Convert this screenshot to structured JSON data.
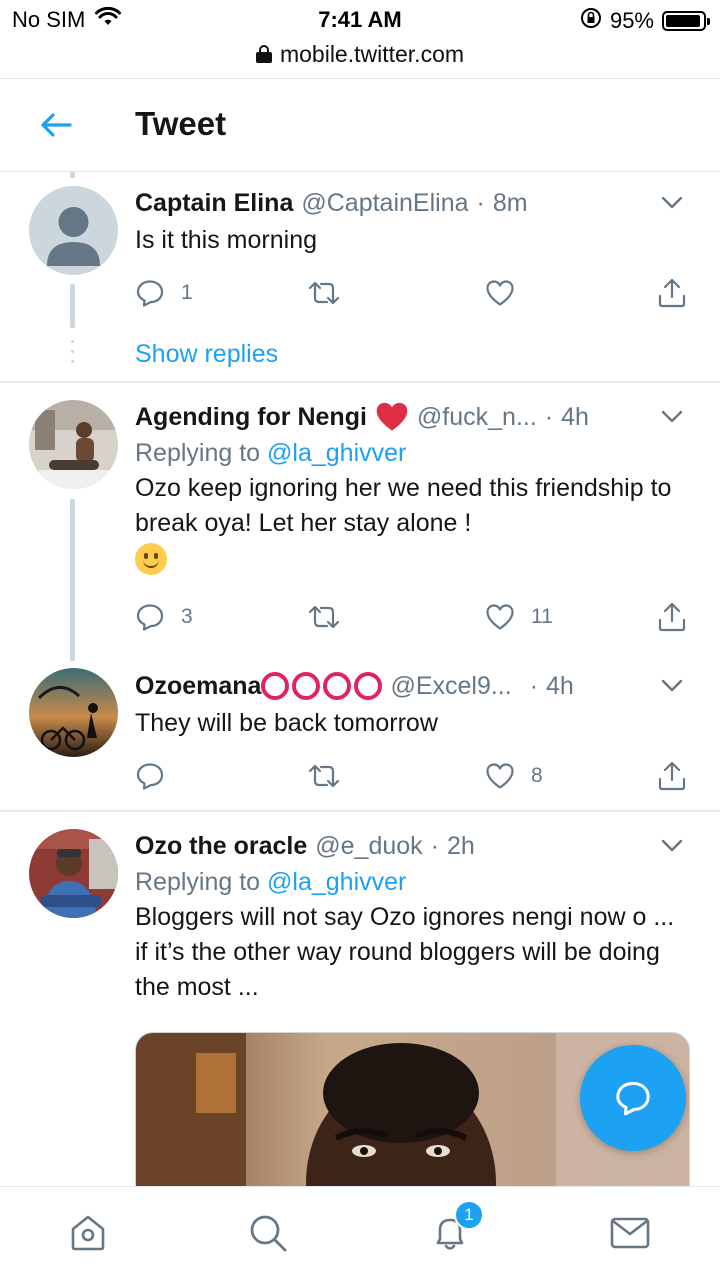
{
  "status_bar": {
    "carrier": "No SIM",
    "time": "7:41 AM",
    "battery_percent": "95%",
    "battery_level": 0.95,
    "url": "mobile.twitter.com"
  },
  "header": {
    "title": "Tweet",
    "back_icon": "back-arrow-icon"
  },
  "tweets": [
    {
      "name": "Captain Elina",
      "handle": "@CaptainElina",
      "separator": "·",
      "time": "8m",
      "text": "Is it this morning",
      "reply_count": "1",
      "retweet_count": "",
      "like_count": "",
      "show_replies": "Show replies"
    },
    {
      "name": "Agending for Nengi",
      "handle": "@fuck_n...",
      "separator": "·",
      "time": "4h",
      "replying_prefix": "Replying to",
      "replying_to": "@la_ghivver",
      "text": "Ozo keep ignoring her we need this friendship to break oya! Let her stay alone !",
      "reply_count": "3",
      "retweet_count": "",
      "like_count": "11"
    },
    {
      "name": "Ozoemana",
      "handle": "@Excel9...",
      "separator": "·",
      "time": "4h",
      "text": "They will be back tomorrow",
      "reply_count": "",
      "retweet_count": "",
      "like_count": "8"
    },
    {
      "name": "Ozo the oracle",
      "handle": "@e_duok",
      "separator": "·",
      "time": "2h",
      "replying_prefix": "Replying to",
      "replying_to": "@la_ghivver",
      "text": "Bloggers will not say Ozo ignores nengi now o ... if it’s the other way round bloggers will be doing the most ..."
    }
  ],
  "bottom_nav": {
    "notifications_badge": "1",
    "items": [
      "home-icon",
      "search-icon",
      "notifications-icon",
      "messages-icon"
    ]
  },
  "colors": {
    "accent": "#1da1f2",
    "text_secondary": "#657786",
    "like_red": "#e0245e"
  }
}
